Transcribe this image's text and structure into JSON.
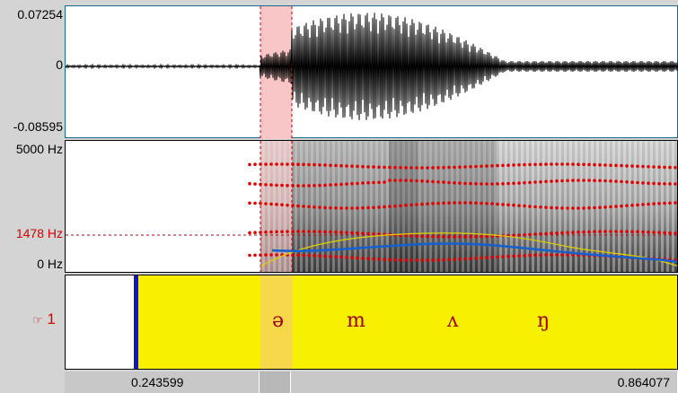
{
  "waveform": {
    "max_label": "0.07254",
    "zero_label": "0",
    "min_label": "-0.08595"
  },
  "spectrogram": {
    "top_label": "5000 Hz",
    "cursor_label": "1478 Hz",
    "bottom_label": "0 Hz"
  },
  "tier": {
    "number_label": "1",
    "hand_icon": "pointing-hand-icon",
    "segments": [
      "ə",
      "m",
      "ʌ",
      "ŋ"
    ]
  },
  "time_bar": {
    "left_time": "0.243599",
    "right_time": "0.864077"
  },
  "colors": {
    "selection": "#f8c6c6",
    "tier_fill": "#f7f000",
    "boundary": "#1515c8",
    "formant": "#e00000",
    "pitch": "#1560d0",
    "intensity": "#e0d000"
  }
}
